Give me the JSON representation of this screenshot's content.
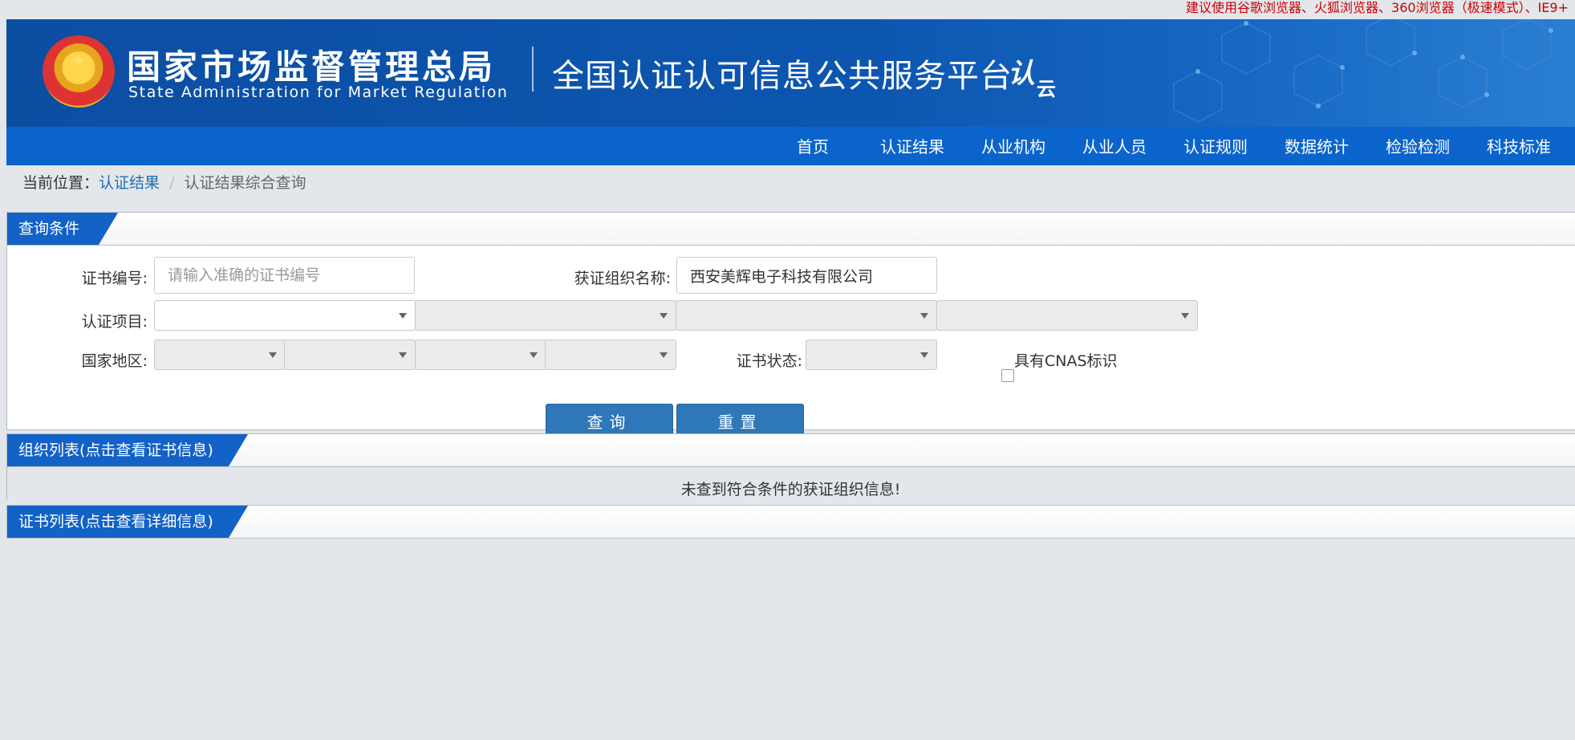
{
  "top_notice": "建议使用谷歌浏览器、火狐浏览器、360浏览器（极速模式）、IE9+",
  "header": {
    "agency_cn": "国家市场监督管理总局",
    "agency_en": "State Administration  for  Market Regulation",
    "platform": "全国认证认可信息公共服务平台",
    "logo_text": "认",
    "logo_sub": "云"
  },
  "nav": [
    "首页",
    "认证结果",
    "从业机构",
    "从业人员",
    "认证规则",
    "数据统计",
    "检验检测",
    "科技标准"
  ],
  "breadcrumb": {
    "prefix": "当前位置：",
    "link": "认证结果",
    "separator": "/",
    "current": "认证结果综合查询"
  },
  "query_panel": {
    "title": "查询条件",
    "cert_no_label": "证书编号:",
    "cert_no_placeholder": "请输入准确的证书编号",
    "org_name_label": "获证组织名称:",
    "org_name_value": "西安美辉电子科技有限公司",
    "project_label": "认证项目:",
    "region_label": "国家地区:",
    "status_label": "证书状态:",
    "cnas_label": "具有CNAS标识",
    "search_button": "查询",
    "reset_button": "重置"
  },
  "org_list": {
    "title": "组织列表(点击查看证书信息)",
    "empty_message": "未查到符合条件的获证组织信息!"
  },
  "cert_list": {
    "title": "证书列表(点击查看详细信息)"
  },
  "colors": {
    "banner": "#0c4ea2",
    "navbar": "#0b64cc",
    "panel_tab": "#1262c7",
    "button": "#2e77b9",
    "notice": "#cc0000"
  }
}
